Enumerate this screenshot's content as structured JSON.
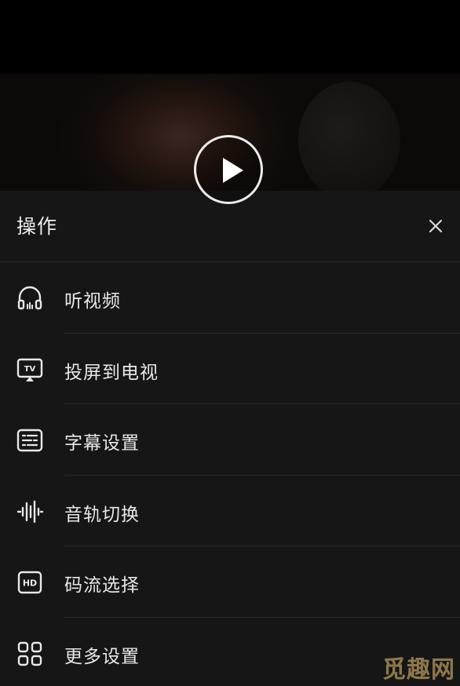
{
  "sheet": {
    "title": "操作"
  },
  "menu": {
    "items": [
      {
        "label": "听视频",
        "icon": "headphones-icon"
      },
      {
        "label": "投屏到电视",
        "icon": "tv-cast-icon"
      },
      {
        "label": "字幕设置",
        "icon": "subtitles-icon"
      },
      {
        "label": "音轨切换",
        "icon": "audio-waveform-icon"
      },
      {
        "label": "码流选择",
        "icon": "hd-icon"
      },
      {
        "label": "更多设置",
        "icon": "grid-icon"
      }
    ]
  },
  "watermark": {
    "text": "觅趣网"
  },
  "colors": {
    "sheet_background": "#161616",
    "text": "#e8e8e8",
    "divider": "#2a2a2a"
  }
}
